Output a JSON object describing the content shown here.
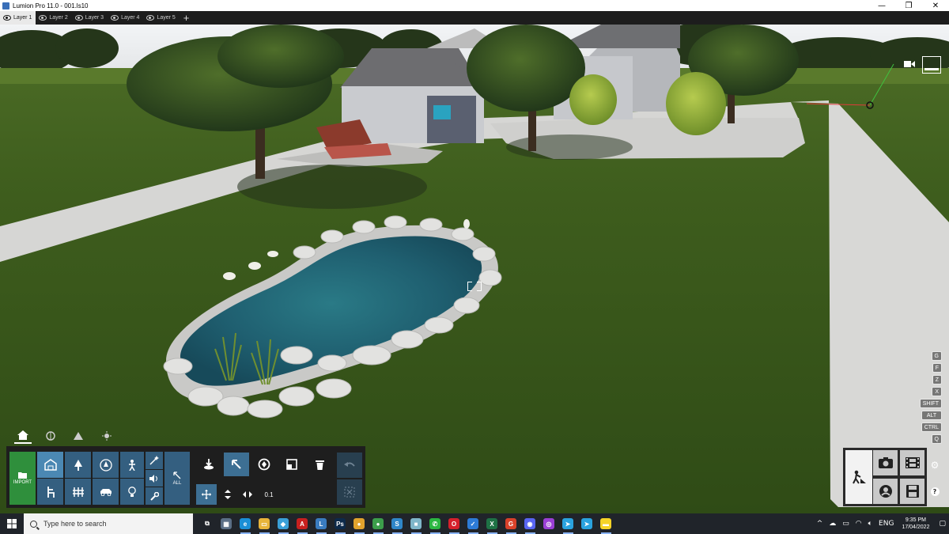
{
  "window": {
    "title": "Lumion Pro 11.0 - 001.ls10",
    "controls": {
      "minimize": "—",
      "maximize": "❐",
      "close": "✕"
    }
  },
  "layers": {
    "tabs": [
      {
        "label": "Layer 1",
        "active": true
      },
      {
        "label": "Layer 2",
        "active": false
      },
      {
        "label": "Layer 3",
        "active": false
      },
      {
        "label": "Layer 4",
        "active": false
      },
      {
        "label": "Layer 5",
        "active": false
      }
    ],
    "add_label": "+"
  },
  "viewport": {
    "shortcut_keys": [
      "G",
      "F",
      "Z",
      "X",
      "SHIFT",
      "ALT",
      "CTRL",
      "Q"
    ],
    "icons": [
      "camera-icon",
      "view-thumbnail-icon",
      "focus-bracket-icon",
      "pivot-gizmo-icon"
    ]
  },
  "toolbox": {
    "tabs": [
      "home-icon",
      "material-icon",
      "landscape-icon",
      "weather-icon"
    ],
    "import_label": "IMPORT",
    "all_label": "ALL",
    "categories_top": [
      "nature-category-icon",
      "tree-icon",
      "special-tree-icon",
      "people-icon",
      "effects-icon"
    ],
    "categories_bottom": [
      "indoor-icon",
      "fence-icon",
      "transport-icon",
      "light-icon",
      "sound-icon",
      "utility-icon"
    ],
    "tools_top": [
      "place-object-icon",
      "select-icon",
      "rotate-icon",
      "scale-icon",
      "delete-icon",
      "undo-icon"
    ],
    "tools_bottom": [
      "move-icon",
      "height-icon",
      "spread-icon",
      "value-icon",
      "deselect-icon"
    ],
    "value_label": "0.1"
  },
  "modes": {
    "items": [
      "build-mode-icon",
      "photo-mode-icon",
      "movie-mode-icon",
      "panorama-mode-icon",
      "save-icon",
      "settings-icon",
      "help-icon"
    ]
  },
  "taskbar": {
    "search_placeholder": "Type here to search",
    "apps": [
      {
        "name": "task-view-icon",
        "color": "#20242a",
        "glyph": "⧉"
      },
      {
        "name": "calculator-icon",
        "color": "#5b6f86",
        "glyph": "▦"
      },
      {
        "name": "edge-icon",
        "color": "#1a8fd6",
        "glyph": "e"
      },
      {
        "name": "file-explorer-icon",
        "color": "#e8b43a",
        "glyph": "▭"
      },
      {
        "name": "app-3d-icon",
        "color": "#3aa0d8",
        "glyph": "◆"
      },
      {
        "name": "autocad-icon",
        "color": "#c8201f",
        "glyph": "A"
      },
      {
        "name": "lumion-icon",
        "color": "#3a7cc0",
        "glyph": "L"
      },
      {
        "name": "photoshop-icon",
        "color": "#0d2a4a",
        "glyph": "Ps"
      },
      {
        "name": "chrome-icon",
        "color": "#e2a32d",
        "glyph": "●"
      },
      {
        "name": "chrome-profile-icon",
        "color": "#3c9e4b",
        "glyph": "●"
      },
      {
        "name": "sketchup-icon",
        "color": "#2f86c8",
        "glyph": "S"
      },
      {
        "name": "app-cube-icon",
        "color": "#7fb6c9",
        "glyph": "■"
      },
      {
        "name": "whatsapp-icon",
        "color": "#2bb741",
        "glyph": "✆"
      },
      {
        "name": "opera-icon",
        "color": "#d6202b",
        "glyph": "O"
      },
      {
        "name": "todo-icon",
        "color": "#2d7bd6",
        "glyph": "✓"
      },
      {
        "name": "excel-icon",
        "color": "#1e7145",
        "glyph": "X"
      },
      {
        "name": "grammarly-icon",
        "color": "#d9412a",
        "glyph": "G"
      },
      {
        "name": "discord-icon",
        "color": "#5865f2",
        "glyph": "◉"
      },
      {
        "name": "podcast-icon",
        "color": "#9b3fd6",
        "glyph": "◎"
      },
      {
        "name": "telegram-icon",
        "color": "#2aa3df",
        "glyph": "➤"
      },
      {
        "name": "telegram-2-icon",
        "color": "#2aa3df",
        "glyph": "➤"
      },
      {
        "name": "sticky-notes-icon",
        "color": "#f5d327",
        "glyph": "▬"
      }
    ],
    "tray": {
      "chevron": "^",
      "language": "ENG",
      "time": "9:35 PM",
      "date": "17/04/2022"
    }
  }
}
